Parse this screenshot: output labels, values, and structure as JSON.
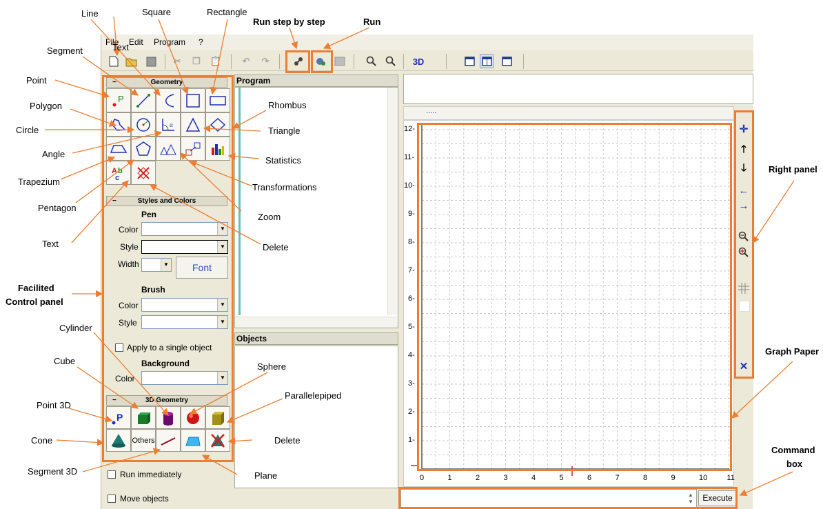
{
  "menu": {
    "file": "File",
    "edit": "Edit",
    "program": "Program",
    "help": "?"
  },
  "toolbar": {
    "view3d": "3D"
  },
  "sections": {
    "geometry": "Geometry",
    "styles": "Styles and Colors",
    "geometry3d": "3D Geometry",
    "minus": "−"
  },
  "pen": {
    "title": "Pen",
    "color_label": "Color",
    "style_label": "Style",
    "width_label": "Width",
    "font_button": "Font"
  },
  "brush": {
    "title": "Brush",
    "color_label": "Color",
    "style_label": "Style"
  },
  "apply_single": "Apply to a single object",
  "background": {
    "title": "Background",
    "color_label": "Color"
  },
  "others_button": "Others",
  "run_immediately": "Run immediately",
  "move_objects": "Move objects",
  "panels": {
    "program": "Program",
    "objects": "Objects"
  },
  "execute_button": "Execute",
  "graph": {
    "x_ticks": [
      "0",
      "1",
      "2",
      "3",
      "4",
      "5",
      "6",
      "7",
      "8",
      "9",
      "10",
      "11"
    ],
    "y_ticks": [
      "1-",
      "2-",
      "3-",
      "4-",
      "5-",
      "6-",
      "7-",
      "8-",
      "9-",
      "10-",
      "11-",
      "12-"
    ],
    "tab": "....."
  },
  "annotations": {
    "line": "Line",
    "square": "Square",
    "rectangle": "Rectangle",
    "segment": "Segment",
    "point": "Point",
    "polygon": "Polygon",
    "circle": "Circle",
    "angle": "Angle",
    "trapezium": "Trapezium",
    "pentagon": "Pentagon",
    "text_left": "Text",
    "text_top": "Text",
    "rhombus": "Rhombus",
    "triangle": "Triangle",
    "statistics": "Statistics",
    "transformations": "Transformations",
    "zoom": "Zoom",
    "delete": "Delete",
    "facilited_1": "Facilited",
    "facilited_2": "Control panel",
    "cylinder": "Cylinder",
    "cube": "Cube",
    "point3d": "Point 3D",
    "cone": "Cone",
    "segment3d": "Segment 3D",
    "sphere": "Sphere",
    "parallelepiped": "Parallelepiped",
    "delete3d": "Delete",
    "plane": "Plane",
    "run_step": "Run step by step",
    "run": "Run",
    "right_panel": "Right panel",
    "graph_paper": "Graph Paper",
    "command_1": "Command",
    "command_2": "box"
  },
  "colors": {
    "annotation": "#ed7d31",
    "accent_blue": "#1f2fb5"
  }
}
